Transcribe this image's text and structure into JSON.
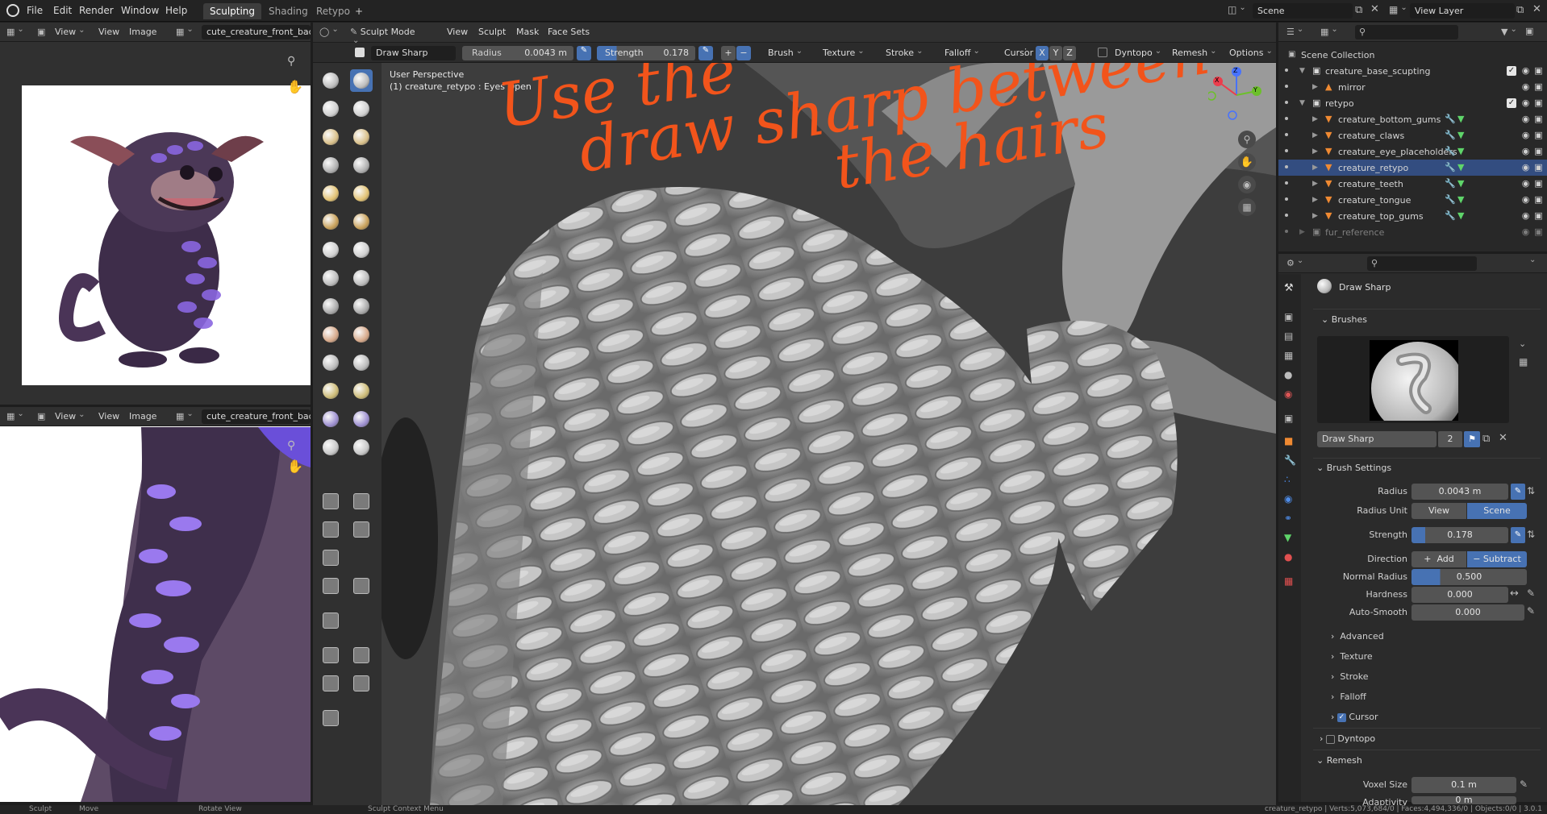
{
  "menubar": {
    "items": [
      "File",
      "Edit",
      "Render",
      "Window",
      "Help"
    ],
    "workspaces": [
      "Sculpting",
      "Shading",
      "Retypo"
    ],
    "active_workspace": "Sculpting",
    "add": "+",
    "scene": "Scene",
    "view_layer": "View Layer"
  },
  "image_editor_top": {
    "view": "View",
    "view2": "View",
    "image": "Image",
    "image_name": "cute_creature_front_back."
  },
  "image_editor_bottom": {
    "view": "View",
    "view2": "View",
    "image": "Image",
    "image_name": "cute_creature_front_back."
  },
  "viewport_header": {
    "mode": "Sculpt Mode",
    "menus": [
      "View",
      "Sculpt",
      "Mask",
      "Face Sets"
    ],
    "brush_name": "Draw Sharp",
    "radius_label": "Radius",
    "radius_value": "0.0043 m",
    "strength_label": "Strength",
    "strength_value": "0.178",
    "plus": "+",
    "minus": "−",
    "dropdowns": [
      "Brush",
      "Texture",
      "Stroke",
      "Falloff",
      "Cursor"
    ],
    "axes": [
      "X",
      "Y",
      "Z"
    ],
    "dyntopo": "Dyntopo",
    "remesh": "Remesh",
    "options": "Options"
  },
  "viewport": {
    "perspective": "User Perspective",
    "object_info": "(1) creature_retypo : Eyes Open",
    "annotation_lines": [
      "Use the",
      "draw sharp between",
      "the hairs"
    ],
    "gizmo": {
      "x": "X",
      "y": "Y",
      "z": "Z"
    }
  },
  "outliner": {
    "root": "Scene Collection",
    "rows": [
      {
        "label": "creature_base_scupting",
        "indent": 0,
        "type": "collection",
        "selected": false
      },
      {
        "label": "mirror",
        "indent": 1,
        "type": "object",
        "selected": false
      },
      {
        "label": "retypo",
        "indent": 0,
        "type": "collection",
        "selected": false
      },
      {
        "label": "creature_bottom_gums",
        "indent": 1,
        "type": "mesh",
        "selected": false
      },
      {
        "label": "creature_claws",
        "indent": 1,
        "type": "mesh",
        "selected": false
      },
      {
        "label": "creature_eye_placeholders",
        "indent": 1,
        "type": "mesh",
        "selected": false
      },
      {
        "label": "creature_retypo",
        "indent": 1,
        "type": "mesh",
        "selected": true
      },
      {
        "label": "creature_teeth",
        "indent": 1,
        "type": "mesh",
        "selected": false
      },
      {
        "label": "creature_tongue",
        "indent": 1,
        "type": "mesh",
        "selected": false
      },
      {
        "label": "creature_top_gums",
        "indent": 1,
        "type": "mesh",
        "selected": false
      },
      {
        "label": "fur_reference",
        "indent": 0,
        "type": "collection",
        "selected": false
      }
    ]
  },
  "properties": {
    "brush_title": "Draw Sharp",
    "brushes_section": "Brushes",
    "brush_field": "Draw Sharp",
    "brush_users": "2",
    "brush_settings_section": "Brush Settings",
    "radius_label": "Radius",
    "radius_value": "0.0043 m",
    "radius_unit_label": "Radius Unit",
    "radius_unit_view": "View",
    "radius_unit_scene": "Scene",
    "strength_label": "Strength",
    "strength_value": "0.178",
    "direction_label": "Direction",
    "direction_add": "Add",
    "direction_subtract": "Subtract",
    "normal_radius_label": "Normal Radius",
    "normal_radius_value": "0.500",
    "hardness_label": "Hardness",
    "hardness_value": "0.000",
    "autosmooth_label": "Auto-Smooth",
    "autosmooth_value": "0.000",
    "subsections": [
      "Advanced",
      "Texture",
      "Stroke",
      "Falloff",
      "Cursor"
    ],
    "dyntopo_section": "Dyntopo",
    "remesh_section": "Remesh",
    "voxel_label": "Voxel Size",
    "voxel_value": "0.1 m",
    "adaptivity_label": "Adaptivity",
    "adaptivity_value": "0 m"
  },
  "statusbar": {
    "items": [
      "Sculpt",
      "Move",
      "Rotate View",
      "Sculpt Context Menu"
    ],
    "info": "creature_retypo | Verts:5,073,684/0 | Faces:4,494,336/0 | Objects:0/0 | 3.0.1"
  },
  "colors": {
    "accent": "#4772b3",
    "annotation": "#f2541b",
    "selection": "#334d80"
  }
}
